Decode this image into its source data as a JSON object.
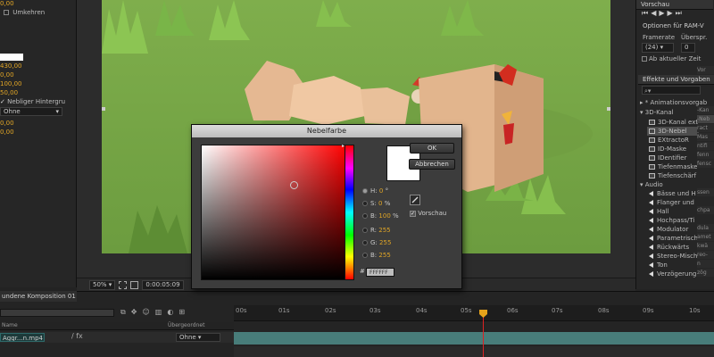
{
  "left_panel": {
    "checkbox_label": "Umkehren",
    "values": [
      "0,00",
      "430,00",
      "0,00",
      "100,00",
      "50,00"
    ],
    "toggle_label": "Nebliger Hintergru",
    "dropdown_value": "Ohne",
    "partial_values": [
      "0,00",
      "0,00"
    ]
  },
  "viewer": {
    "zoom": "50%",
    "timecode": "0:00:05:09"
  },
  "right_panel": {
    "vorschau_label": "Vorschau",
    "ram_options": "Optionen für RAM-V",
    "framerate_label": "Framerate",
    "ueberspr_label": "Überspr.",
    "framerate_value": "(24)",
    "ueberspr_value": "0",
    "ab_aktueller_zeit": "Ab aktueller Zeit",
    "effects_header": "Effekte und Vorgaben",
    "search_placeholder": "",
    "tree": {
      "animation_presets": "* Animationsvorgab",
      "channel_3d": "3D-Kanal",
      "items_3d": [
        "3D-Kanal ext",
        "3D-Nebel",
        "EXtractoR",
        "ID-Maske",
        "IDentifier",
        "Tiefenmaske",
        "Tiefenschärf"
      ],
      "audio": "Audio",
      "items_audio": [
        "Bässe und H",
        "Flanger und",
        "Hall",
        "Hochpass/Ti",
        "Modulator",
        "Parametrisch",
        "Rückwärts",
        "Stereo-Misch",
        "Ton",
        "Verzögerung"
      ]
    },
    "strip_items": [
      "Vor",
      "-Kan",
      "-Neb",
      "ract",
      "Mas",
      "ntifi",
      "fenn",
      "fensc",
      "ssen",
      "chpa",
      "dula",
      "amet",
      "kwä",
      "reo-",
      "n",
      "zög"
    ]
  },
  "dialog": {
    "title": "Nebelfarbe",
    "ok_label": "OK",
    "cancel_label": "Abbrechen",
    "preview_label": "Vorschau",
    "fields": [
      {
        "label": "H:",
        "value": "0",
        "unit": "°",
        "selected": true
      },
      {
        "label": "S:",
        "value": "0",
        "unit": "%",
        "selected": false
      },
      {
        "label": "B:",
        "value": "100",
        "unit": "%",
        "selected": false
      },
      {
        "label": "R:",
        "value": "255",
        "unit": "",
        "selected": false
      },
      {
        "label": "G:",
        "value": "255",
        "unit": "",
        "selected": false
      },
      {
        "label": "B:",
        "value": "255",
        "unit": "",
        "selected": false
      }
    ],
    "hash": "#",
    "hex": "FFFFFF",
    "selected_color": "#FFFFFF"
  },
  "timeline": {
    "tab_label": "undene Komposition 01",
    "col_name": "Name",
    "col_parent": "Übergeordnet",
    "layer_name": "Aggr...n.mp4",
    "layer_parent": "Ohne",
    "ticks": [
      "00s",
      "01s",
      "02s",
      "03s",
      "04s",
      "05s",
      "06s",
      "07s",
      "08s",
      "09s",
      "10s"
    ],
    "track_color": "#487D7A",
    "playhead_color": "#DD2222"
  }
}
